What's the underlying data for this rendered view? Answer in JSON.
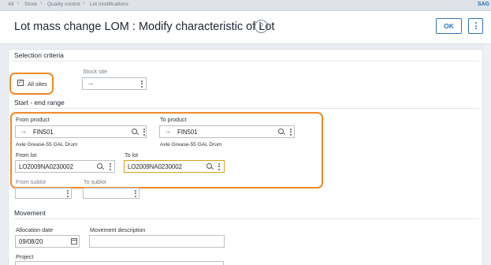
{
  "breadcrumb": [
    "All",
    "Stock",
    "Quality control",
    "Lot modifications"
  ],
  "brand": "SAG",
  "page_title": "Lot mass change LOM : Modify characteristic of Lot",
  "help_icon": "?",
  "ok_label": "OK",
  "sections": {
    "selection_criteria": "Selection criteria",
    "start_end_range": "Start - end range",
    "movement": "Movement"
  },
  "all_sites": {
    "label": "All sites",
    "checked": true
  },
  "stock_site": {
    "label": "Stock site",
    "value": ""
  },
  "from_product": {
    "label": "From product",
    "value": "FIN501",
    "description": "Axle Grease-55 GAL Drum"
  },
  "to_product": {
    "label": "To product",
    "value": "FIN501",
    "description": "Axle Grease-55 GAL Drum"
  },
  "from_lot": {
    "label": "From lot",
    "value": "LO2009NA0230002"
  },
  "to_lot": {
    "label": "To lot",
    "value": "LO2009NA0230002"
  },
  "from_sublot": {
    "label": "From sublot",
    "value": ""
  },
  "to_sublot": {
    "label": "To sublot",
    "value": ""
  },
  "allocation_date": {
    "label": "Allocation date",
    "value": "09/08/20"
  },
  "movement_description": {
    "label": "Movement description",
    "value": ""
  },
  "project": {
    "label": "Project"
  },
  "colors": {
    "accent": "#2f74b5",
    "highlight": "#f08a24",
    "focus": "#d6a21e"
  }
}
